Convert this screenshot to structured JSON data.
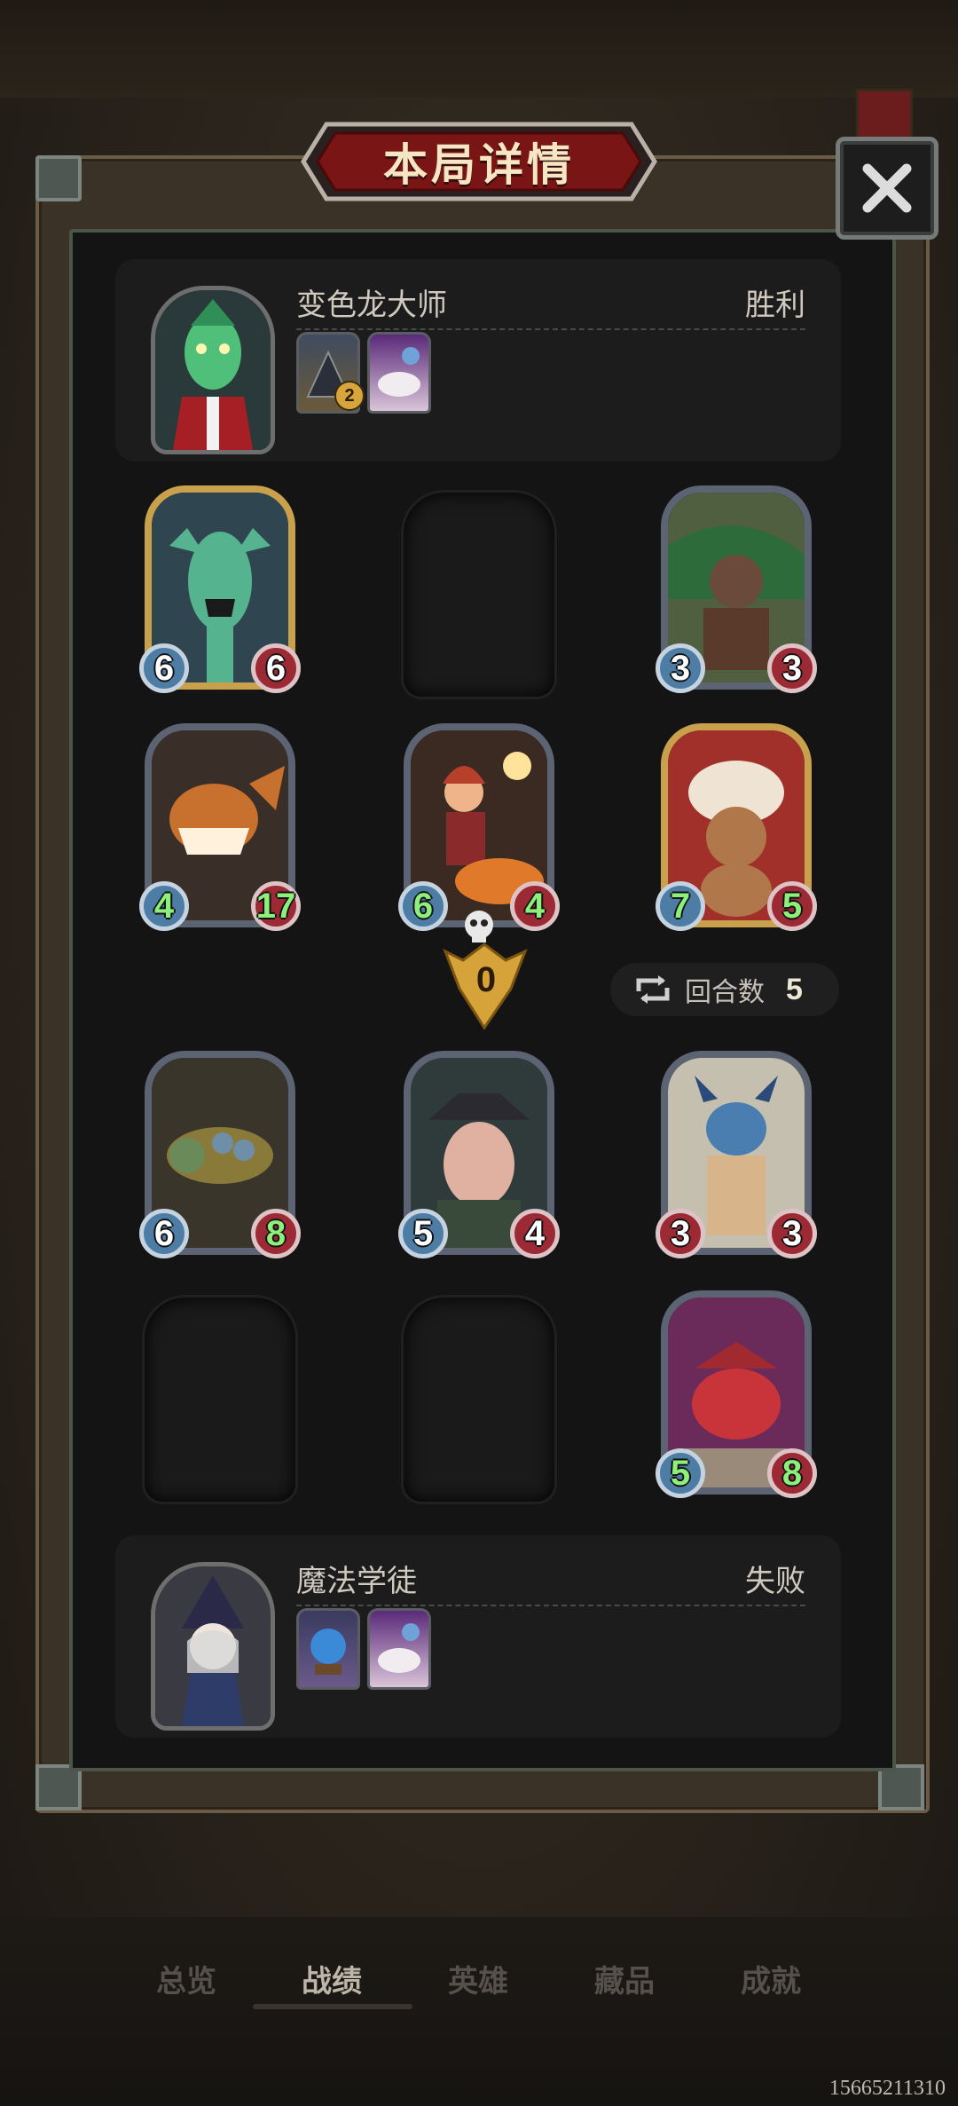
{
  "title": "本局详情",
  "top_player": {
    "name": "变色龙大师",
    "result": "胜利",
    "item_badge": "2"
  },
  "bottom_player": {
    "name": "魔法学徒",
    "result": "失败"
  },
  "round": {
    "label": "回合数",
    "value": "5"
  },
  "marker_value": "0",
  "top_board": [
    {
      "atk": "6",
      "hp": "6",
      "frame": "gold"
    },
    {
      "empty": true
    },
    {
      "atk": "3",
      "hp": "3",
      "frame": "silver"
    },
    {
      "atk": "4",
      "hp": "17",
      "frame": "silver"
    },
    {
      "atk": "6",
      "hp": "4",
      "frame": "silver"
    },
    {
      "atk": "7",
      "hp": "5",
      "frame": "gold"
    }
  ],
  "bottom_board": [
    {
      "atk": "6",
      "hp": "8"
    },
    {
      "atk": "5",
      "hp": "4"
    },
    {
      "atk": "3",
      "hp": "3"
    },
    {
      "empty": true
    },
    {
      "empty": true
    },
    {
      "atk": "5",
      "hp": "8"
    }
  ],
  "nav": {
    "overview": "总览",
    "record": "战绩",
    "heroes": "英雄",
    "collection": "藏品",
    "achievements": "成就"
  },
  "watermark": "15665211310"
}
